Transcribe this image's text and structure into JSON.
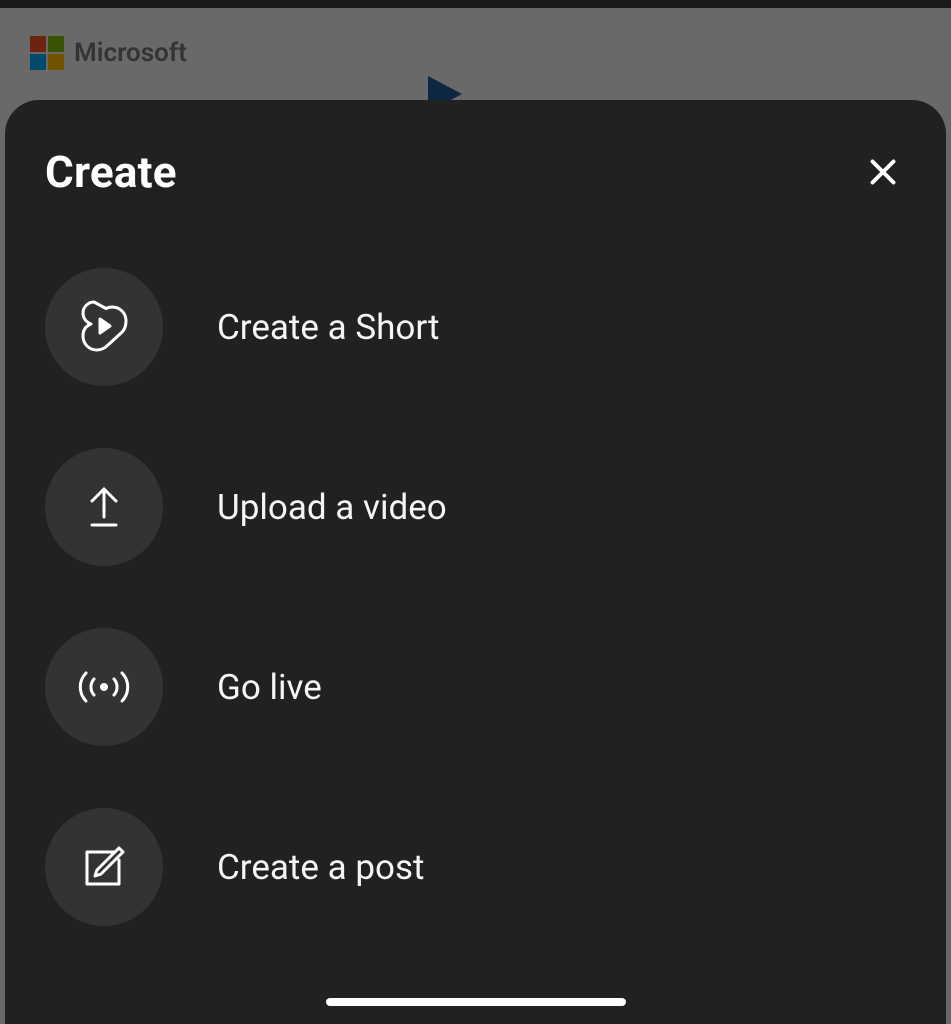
{
  "background": {
    "brand_text": "Microsoft"
  },
  "sheet": {
    "title": "Create",
    "options": [
      {
        "label": "Create a Short"
      },
      {
        "label": "Upload a video"
      },
      {
        "label": "Go live"
      },
      {
        "label": "Create a post"
      }
    ]
  }
}
